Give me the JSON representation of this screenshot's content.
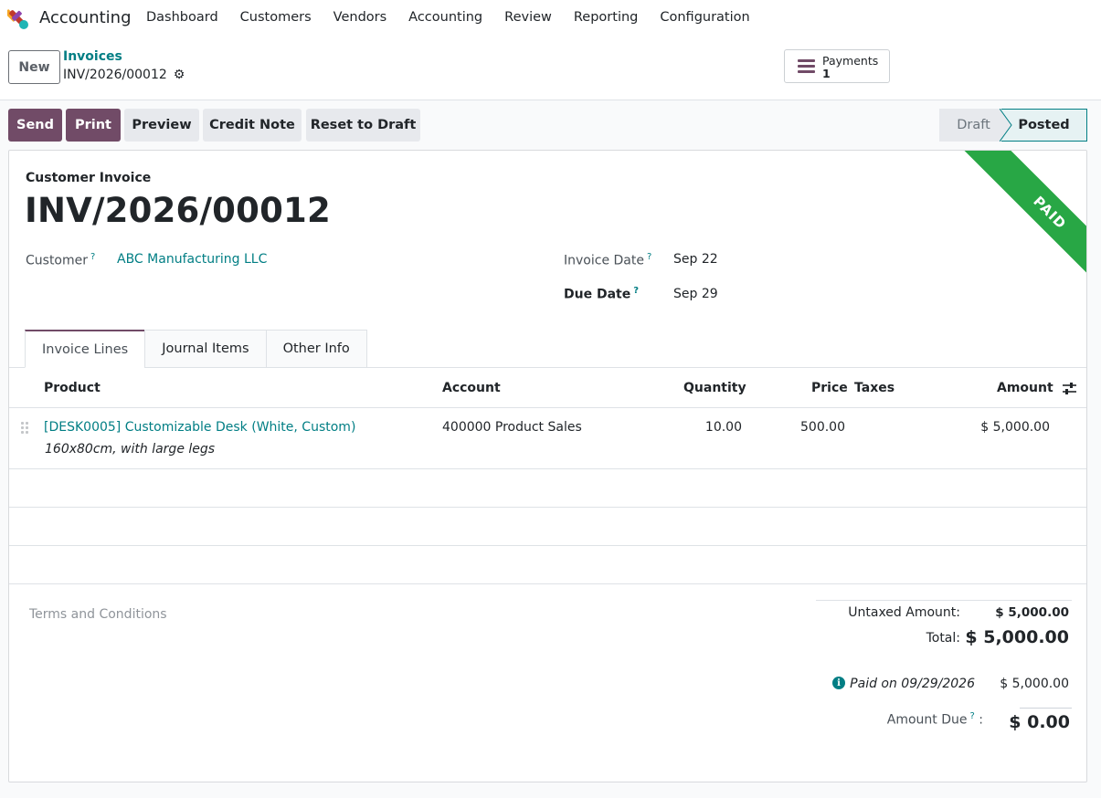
{
  "app": {
    "name": "Accounting"
  },
  "menu": [
    "Dashboard",
    "Customers",
    "Vendors",
    "Accounting",
    "Review",
    "Reporting",
    "Configuration"
  ],
  "control": {
    "new_label": "New",
    "breadcrumb_parent": "Invoices",
    "breadcrumb_current": "INV/2026/00012",
    "smart_button": {
      "label": "Payments",
      "value": "1"
    }
  },
  "actions": {
    "send": "Send",
    "print": "Print",
    "preview": "Preview",
    "credit_note": "Credit Note",
    "reset": "Reset to Draft"
  },
  "stages": {
    "draft": "Draft",
    "posted": "Posted"
  },
  "ribbon": "PAID",
  "invoice": {
    "type": "Customer Invoice",
    "name": "INV/2026/00012",
    "customer_label": "Customer",
    "customer": "ABC Manufacturing LLC",
    "invoice_date_label": "Invoice Date",
    "invoice_date": "Sep 22",
    "due_date_label": "Due Date",
    "due_date": "Sep 29",
    "help_mark": "?"
  },
  "tabs": [
    "Invoice Lines",
    "Journal Items",
    "Other Info"
  ],
  "table": {
    "headers": {
      "product": "Product",
      "account": "Account",
      "quantity": "Quantity",
      "price": "Price",
      "taxes": "Taxes",
      "amount": "Amount"
    },
    "lines": [
      {
        "product": "[DESK0005] Customizable Desk (White, Custom)",
        "description": "160x80cm, with large legs",
        "account": "400000 Product Sales",
        "quantity": "10.00",
        "price": "500.00",
        "taxes": "",
        "amount": "$ 5,000.00"
      }
    ]
  },
  "terms_placeholder": "Terms and Conditions",
  "totals": {
    "untaxed_label": "Untaxed Amount:",
    "untaxed": "$ 5,000.00",
    "total_label": "Total:",
    "total": "$ 5,000.00",
    "paid_label": "Paid on 09/29/2026",
    "paid": "$ 5,000.00",
    "due_label": "Amount Due",
    "due_colon": ":",
    "due": "$ 0.00"
  },
  "colors": {
    "brand": "#714b67",
    "link": "#017e84",
    "paid_ribbon": "#28a745"
  }
}
